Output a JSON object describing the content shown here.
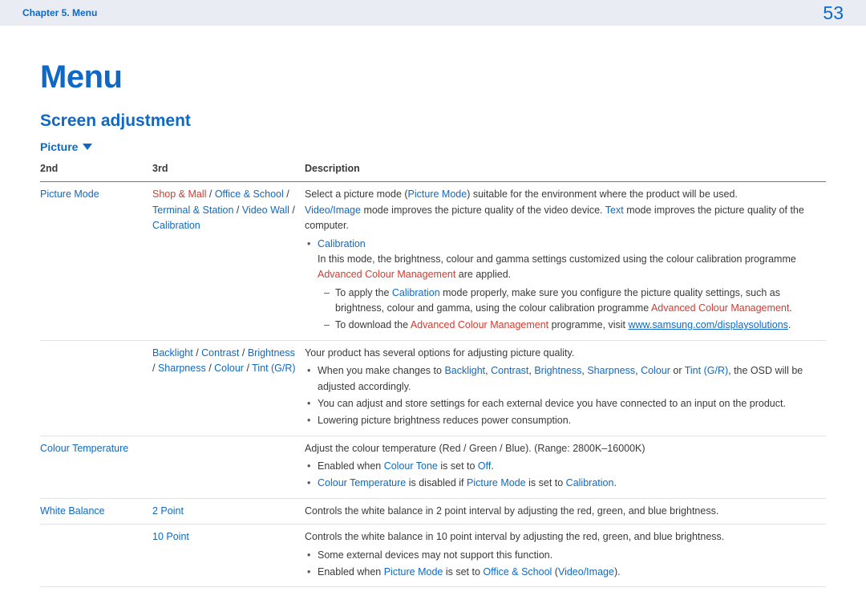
{
  "header": {
    "breadcrumb": "Chapter 5. Menu",
    "page_number": "53"
  },
  "title": "Menu",
  "section_title": "Screen adjustment",
  "tab": {
    "label": "Picture"
  },
  "columns": {
    "c1": "2nd",
    "c2": "3rd",
    "c3": "Description"
  },
  "terms": {
    "picture_mode": "Picture Mode",
    "shop_mall": "Shop & Mall",
    "office_school": "Office & School",
    "terminal_station": "Terminal & Station",
    "video_wall": "Video Wall",
    "calibration": "Calibration",
    "video_image": "Video/Image",
    "text": "Text",
    "advanced_colour_mgmt": "Advanced Colour Management",
    "backlight": "Backlight",
    "contrast": "Contrast",
    "brightness": "Brightness",
    "sharpness": "Sharpness",
    "colour": "Colour",
    "tint_gr": "Tint (G/R)",
    "colour_temperature": "Colour Temperature",
    "colour_tone": "Colour Tone",
    "off": "Off",
    "white_balance": "White Balance",
    "two_point": "2 Point",
    "ten_point": "10 Point",
    "url": "www.samsung.com/displaysolutions"
  },
  "text": {
    "sep_slash": " / ",
    "r1_desc_1a": "Select a picture mode (",
    "r1_desc_1b": ") suitable for the environment where the product will be used.",
    "r1_desc_2a": " mode improves the picture quality of the video device. ",
    "r1_desc_2b": " mode improves the picture quality of the computer.",
    "r1_cal_line_a": "In this mode, the brightness, colour and gamma settings customized using the colour calibration programme ",
    "r1_cal_line_b": " are applied.",
    "r1_dash1_a": "To apply the ",
    "r1_dash1_b": " mode properly, make sure you configure the picture quality settings, such as brightness, colour and gamma, using the colour calibration programme ",
    "r1_dash1_c": ".",
    "r1_dash2_a": "To download the ",
    "r1_dash2_b": " programme, visit ",
    "r1_dash2_c": ".",
    "r2_desc_1": "Your product has several options for adjusting picture quality.",
    "r2_b1_a": "When you make changes to ",
    "r2_b1_sep": ", ",
    "r2_b1_or": " or ",
    "r2_b1_b": ", the OSD will be adjusted accordingly.",
    "r2_b2": "You can adjust and store settings for each external device you have connected to an input on the product.",
    "r2_b3": "Lowering picture brightness reduces power consumption.",
    "r3_desc_1": "Adjust the colour temperature (Red / Green / Blue). (Range: 2800K–16000K)",
    "r3_b1_a": "Enabled when ",
    "r3_b1_b": " is set to ",
    "r3_b1_c": ".",
    "r3_b2_a": " is disabled if ",
    "r3_b2_b": " is set to ",
    "r3_b2_c": ".",
    "r4_desc": "Controls the white balance in 2 point interval by adjusting the red, green, and blue brightness.",
    "r5_desc": "Controls the white balance in 10 point interval by adjusting the red, green, and blue brightness.",
    "r5_b1": "Some external devices may not support this function.",
    "r5_b2_a": "Enabled when ",
    "r5_b2_b": " is set to ",
    "r5_b2_paren_open": " (",
    "r5_b2_paren_close": ")."
  }
}
